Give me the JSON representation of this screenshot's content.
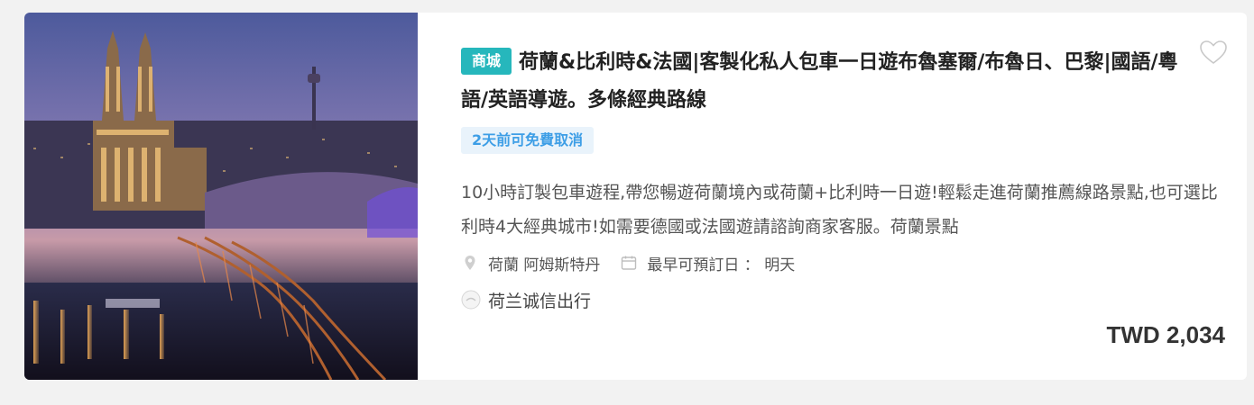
{
  "product": {
    "tag": "商城",
    "title": "荷蘭&比利時&法國|客製化私人包車一日遊布魯塞爾/布魯日、巴黎|國語/粵語/英語導遊。多條經典路線",
    "cancel_badge": "2天前可免費取消",
    "description": "10小時訂製包車遊程,帶您暢遊荷蘭境內或荷蘭+比利時一日遊!輕鬆走進荷蘭推薦線路景點,也可選比利時4大經典城市!如需要德國或法國遊請諮詢商家客服。荷蘭景點",
    "location": "荷蘭 阿姆斯特丹",
    "earliest_booking": "最早可預訂日 ： 明天",
    "merchant": "荷兰诚信出行",
    "price": "TWD 2,034",
    "icons": {
      "favorite": "heart-outline-icon",
      "location": "map-pin-icon",
      "date": "calendar-icon",
      "merchant": "merchant-logo-icon"
    },
    "colors": {
      "tag_bg": "#26b7bc",
      "cancel_bg": "#e9f3fb",
      "cancel_text": "#3d9ee6"
    }
  }
}
